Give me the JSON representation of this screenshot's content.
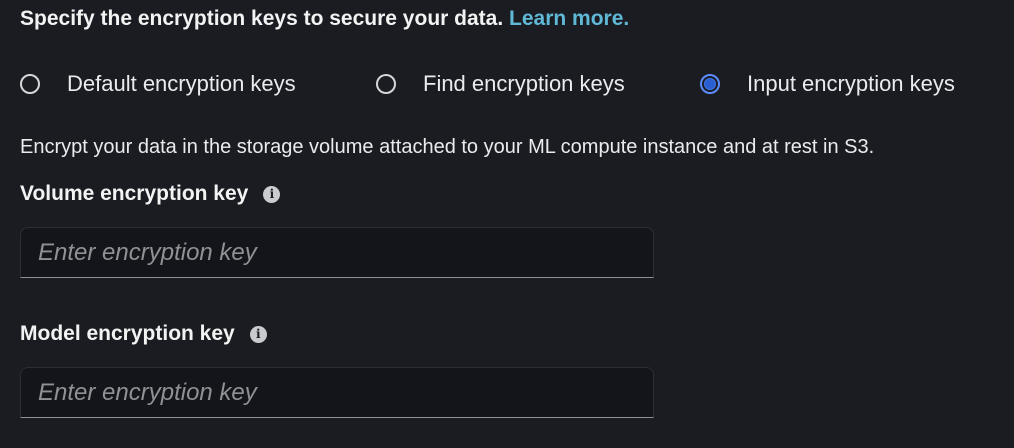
{
  "header": {
    "text": "Specify the encryption keys to secure your data.",
    "link": "Learn more."
  },
  "encryption_options": [
    {
      "label": "Default encryption keys",
      "selected": false
    },
    {
      "label": "Find encryption keys",
      "selected": false
    },
    {
      "label": "Input encryption keys",
      "selected": true
    }
  ],
  "description": "Encrypt your data in the storage volume attached to your ML compute instance and at rest in S3.",
  "volume_key": {
    "label": "Volume encryption key",
    "info_icon": "info-icon",
    "placeholder": "Enter encryption key",
    "value": ""
  },
  "model_key": {
    "label": "Model encryption key",
    "info_icon": "info-icon",
    "placeholder": "Enter encryption key",
    "value": ""
  },
  "colors": {
    "background": "#1b1c21",
    "link": "#5fb8d6",
    "radio_selected": "#2a5fd1",
    "input_background": "#14151a"
  }
}
